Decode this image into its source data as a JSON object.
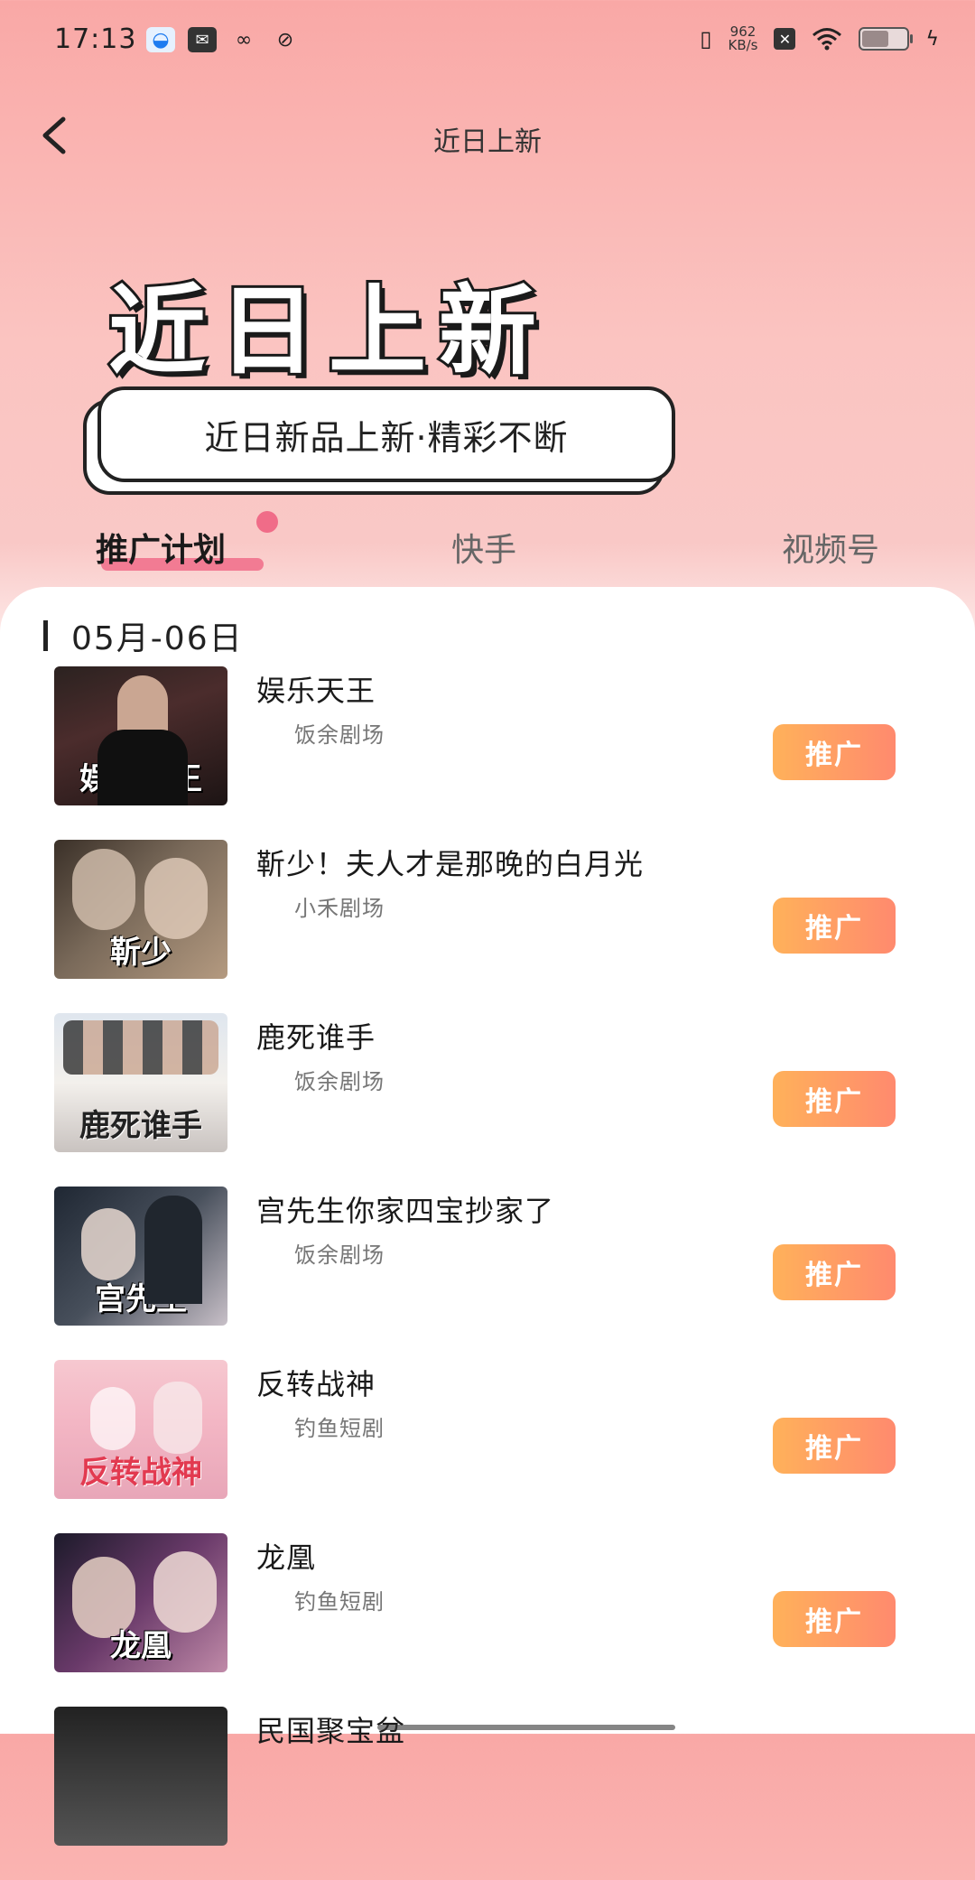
{
  "status": {
    "time": "17:13",
    "net_speed_value": "962",
    "net_speed_unit": "KB/s",
    "battery_level": 0.6
  },
  "nav": {
    "title": "近日上新"
  },
  "hero": {
    "title": "近日上新",
    "tagline": "近日新品上新·精彩不断"
  },
  "tabs": [
    {
      "label": "推广计划",
      "active": true
    },
    {
      "label": "快手",
      "active": false
    },
    {
      "label": "视频号",
      "active": false
    }
  ],
  "date_label": "05月-06日",
  "items": [
    {
      "title": "娱乐天王",
      "source": "饭余剧场",
      "poster_text": "娱乐天王",
      "button": "推广"
    },
    {
      "title": "靳少！夫人才是那晚的白月光",
      "source": "小禾剧场",
      "poster_text": "靳少",
      "button": "推广"
    },
    {
      "title": "鹿死谁手",
      "source": "饭余剧场",
      "poster_text": "鹿死谁手",
      "button": "推广"
    },
    {
      "title": "宫先生你家四宝抄家了",
      "source": "饭余剧场",
      "poster_text": "宫先生",
      "button": "推广"
    },
    {
      "title": "反转战神",
      "source": "钓鱼短剧",
      "poster_text": "反转战神",
      "button": "推广"
    },
    {
      "title": "龙凰",
      "source": "钓鱼短剧",
      "poster_text": "龙凰",
      "button": "推广"
    },
    {
      "title": "民国聚宝盆",
      "source": "",
      "poster_text": "",
      "button": ""
    }
  ],
  "icons": {
    "back": "chevron-left-icon",
    "vibrate": "vibrate-icon",
    "wifi": "wifi-icon",
    "battery": "battery-icon",
    "charging": "bolt-icon"
  }
}
